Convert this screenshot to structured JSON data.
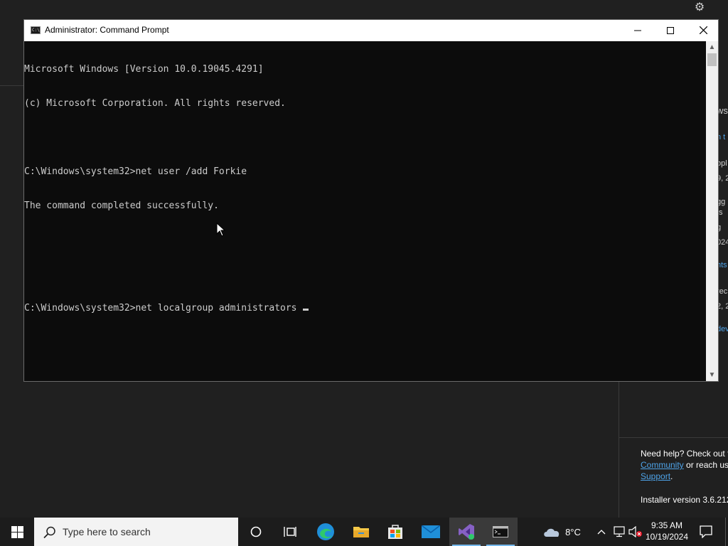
{
  "background": {
    "fragments": [
      "ws",
      "n t",
      "opl",
      "9, 2",
      "gg",
      "ts",
      "g",
      "024",
      "hts",
      "rec",
      "2, 2",
      "dev"
    ],
    "help": {
      "text1": "Need help? Check out t",
      "community_link": "Community",
      "text2": " or reach us",
      "support_link": "Support",
      "text3": "."
    },
    "installer_version": "Installer version 3.6.212"
  },
  "window": {
    "title": "Administrator: Command Prompt",
    "icon_text": "C:\\",
    "minimize_label": "—",
    "maximize_label": "☐",
    "close_label": "✕"
  },
  "console": {
    "lines": [
      "Microsoft Windows [Version 10.0.19045.4291]",
      "(c) Microsoft Corporation. All rights reserved.",
      "",
      "C:\\Windows\\system32>net user /add Forkie",
      "The command completed successfully.",
      "",
      "",
      "C:\\Windows\\system32>net localgroup administrators"
    ]
  },
  "taskbar": {
    "search_placeholder": "Type here to search",
    "weather_temp": "8°C",
    "time": "9:35 AM",
    "date": "10/19/2024",
    "accent": "#76b9ed"
  }
}
